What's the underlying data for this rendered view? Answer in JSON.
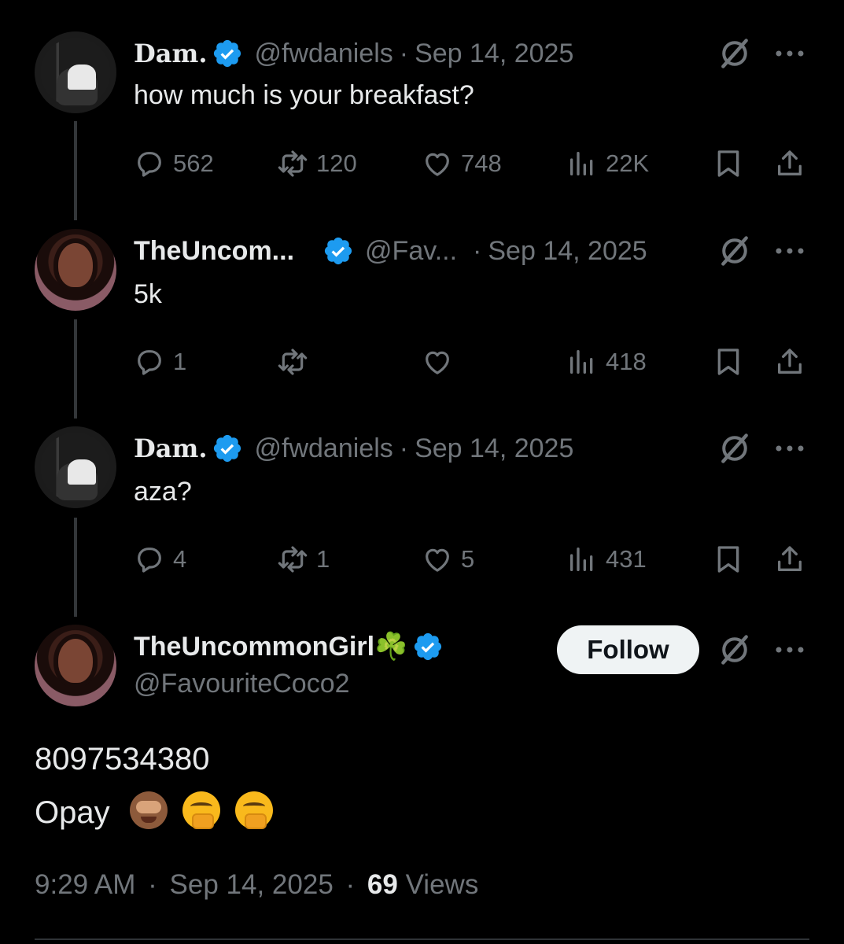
{
  "colors": {
    "background": "#000000",
    "text_primary": "#e7e9ea",
    "text_secondary": "#71767b",
    "verified_blue": "#1d9bf0",
    "follow_bg": "#eff3f4"
  },
  "thread": [
    {
      "name": "Dam.",
      "handle": "@fwdaniels",
      "separator": "·",
      "date": "Sep 14, 2025",
      "text": "how much is your breakfast?",
      "replies": "562",
      "reposts": "120",
      "likes": "748",
      "views": "22K"
    },
    {
      "name": "TheUncom...",
      "handle": "@Fav...",
      "separator": "·",
      "date": "Sep 14, 2025",
      "text": "5k",
      "replies": "1",
      "reposts": "",
      "likes": "",
      "views": "418"
    },
    {
      "name": "Dam.",
      "handle": "@fwdaniels",
      "separator": "·",
      "date": "Sep 14, 2025",
      "text": "aza?",
      "replies": "4",
      "reposts": "1",
      "likes": "5",
      "views": "431"
    }
  ],
  "main_tweet": {
    "name": "TheUncommonGirl☘️",
    "handle": "@FavouriteCoco2",
    "follow_label": "Follow",
    "line1": "8097534380",
    "line2": "Opay",
    "emojis": [
      "see-no-evil-monkey",
      "face-with-hand-over-mouth",
      "face-with-hand-over-mouth"
    ],
    "time": "9:29 AM",
    "separator1": "·",
    "date": "Sep 14, 2025",
    "separator2": "·",
    "views_count": "69",
    "views_label": "Views"
  },
  "icons": {
    "verified": "verified-badge-icon",
    "grok": "grok-icon",
    "more": "more-options-icon",
    "reply": "reply-icon",
    "repost": "repost-icon",
    "like": "heart-icon",
    "views": "views-chart-icon",
    "bookmark": "bookmark-icon",
    "share": "share-icon"
  }
}
